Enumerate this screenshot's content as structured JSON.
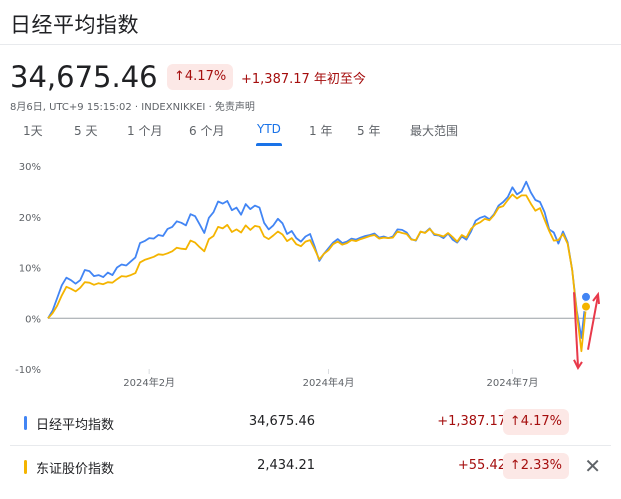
{
  "title": "日经平均指数",
  "price": "34,675.46",
  "change_pct": "↑4.17%",
  "change_abs": "+1,387.17 年初至今",
  "meta": "8月6日, UTC+9 15:15:02 · INDEXNIKKEI · 免责声明",
  "tabs": [
    "1天",
    "5 天",
    "1 个月",
    "6 个月",
    "YTD",
    "1 年",
    "5 年",
    "最大范围"
  ],
  "active_tab": "YTD",
  "colors": {
    "nikkei": "#4285f4",
    "topix": "#f4b400",
    "negative": "#a50e0e",
    "badge_bg": "#fce8e6",
    "zero": "#9aa0a6"
  },
  "chart_data": {
    "type": "line",
    "ylim": [
      -10,
      30
    ],
    "y_ticks": [
      "30%",
      "20%",
      "10%",
      "0%",
      "-10%"
    ],
    "x_ticks": [
      "2024年2月",
      "2024年4月",
      "2024年7月"
    ],
    "x_tick_index": [
      22,
      61,
      101
    ],
    "series": [
      {
        "name": "日经平均指数",
        "color": "#4285f4",
        "values": [
          0,
          1.5,
          4,
          6.5,
          8,
          7.5,
          6.8,
          7.5,
          9.5,
          9.3,
          8.3,
          8.5,
          8.1,
          9,
          8.5,
          10,
          10.6,
          10.4,
          11.2,
          12,
          14.8,
          15.2,
          15.8,
          15.7,
          16.4,
          16.2,
          17.6,
          18,
          19.1,
          18.8,
          18.3,
          20.5,
          20.1,
          18.5,
          16.8,
          19.8,
          20.9,
          23,
          22.6,
          23.1,
          21.3,
          21.8,
          20.4,
          22.5,
          21.5,
          22.2,
          21.8,
          18.8,
          17.5,
          18.3,
          19.6,
          18.7,
          16.6,
          17.2,
          15.8,
          15.1,
          16.1,
          16.6,
          14.1,
          11.3,
          12.7,
          13.8,
          14.9,
          15.6,
          14.8,
          15.1,
          15.7,
          15.5,
          15.9,
          16.2,
          16.4,
          16.7,
          15.9,
          16.1,
          15.8,
          16.1,
          17.5,
          17.4,
          16.9,
          15.6,
          15.3,
          17,
          16.9,
          17.7,
          16.4,
          16.3,
          15.8,
          16.7,
          15.5,
          14.9,
          16.1,
          15.5,
          17.1,
          19.2,
          19.8,
          20.1,
          19.5,
          20.5,
          22.2,
          22.9,
          23.9,
          25.8,
          24.4,
          25,
          26.9,
          24.8,
          23.3,
          22.9,
          20.9,
          17.5,
          16.9,
          14.7,
          17.1,
          15,
          9.5,
          1.5,
          -3.9,
          4.2
        ]
      },
      {
        "name": "东证股价指数",
        "color": "#f4b400",
        "values": [
          0,
          1,
          2.5,
          4.5,
          6.2,
          5.8,
          5.3,
          6,
          7.1,
          7,
          6.6,
          6.9,
          6.7,
          7.1,
          7,
          7.7,
          8.3,
          8.2,
          8.5,
          8.9,
          11,
          11.5,
          11.8,
          12.1,
          12.6,
          12.5,
          12.8,
          13.2,
          13.9,
          13.7,
          13.6,
          15.3,
          14.9,
          14,
          13.2,
          15.6,
          16.2,
          18,
          17.7,
          18.4,
          17,
          17.5,
          16.9,
          18.3,
          17.4,
          18.2,
          18,
          16.1,
          15.6,
          16.3,
          17.1,
          16.5,
          15.2,
          15.8,
          14.6,
          14.2,
          15.1,
          15.4,
          13.6,
          11.6,
          12.7,
          13.4,
          14.6,
          15.1,
          14.5,
          14.8,
          15.4,
          15.2,
          15.6,
          15.9,
          16.2,
          16.4,
          15.7,
          15.9,
          15.8,
          15.9,
          17.1,
          16.8,
          16.6,
          15.5,
          15.4,
          17.1,
          16.8,
          17.6,
          16.6,
          16.4,
          16.1,
          16.8,
          16,
          15.1,
          16.4,
          15.9,
          17.6,
          18.5,
          18.9,
          19.6,
          19.3,
          20.3,
          21.8,
          22.1,
          23.3,
          24.4,
          23.6,
          24.2,
          24.2,
          22.6,
          21.2,
          21.7,
          19.4,
          17.2,
          15.3,
          15.4,
          16.6,
          14.7,
          9.5,
          1,
          -6.5,
          2.3
        ]
      }
    ]
  },
  "rows": [
    {
      "name": "日经平均指数",
      "value": "34,675.46",
      "abs": "+1,387.17",
      "pct": "↑4.17%",
      "color": "#4285f4"
    },
    {
      "name": "东证股价指数",
      "value": "2,434.21",
      "abs": "+55.42",
      "pct": "↑2.33%",
      "color": "#f4b400",
      "close": "✕"
    }
  ]
}
